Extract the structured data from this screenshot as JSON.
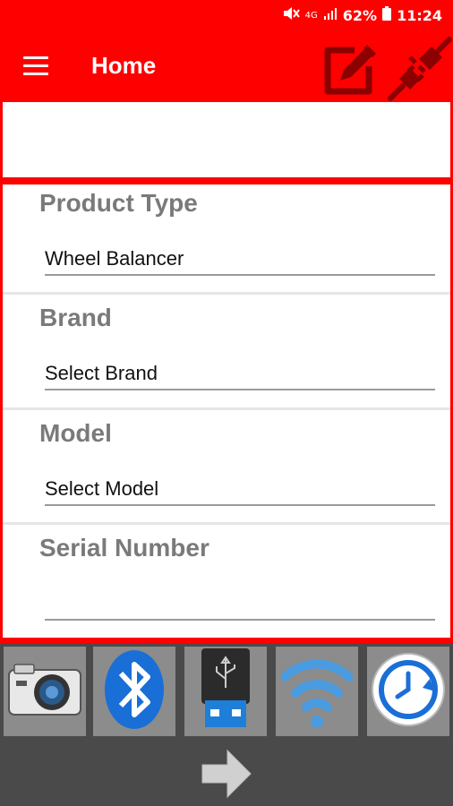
{
  "status_bar": {
    "network": "4G",
    "battery": "62%",
    "time": "11:24"
  },
  "app_bar": {
    "title": "Home",
    "icons": [
      "menu-icon",
      "edit-icon",
      "plug-icon"
    ]
  },
  "form": {
    "product_type": {
      "label": "Product Type",
      "value": "Wheel Balancer"
    },
    "brand": {
      "label": "Brand",
      "value": "Select Brand"
    },
    "model": {
      "label": "Model",
      "value": "Select Model"
    },
    "serial_number": {
      "label": "Serial Number",
      "value": ""
    }
  },
  "toolbar": {
    "buttons": [
      "camera-icon",
      "bluetooth-icon",
      "usb-icon",
      "wifi-icon",
      "history-icon"
    ],
    "next": "arrow-right-icon"
  },
  "colors": {
    "brand_red": "#ff0000",
    "icon_dark_red": "#8b0000",
    "toolbar_bg": "#4a4a4a",
    "label_gray": "#7a7a7a"
  }
}
